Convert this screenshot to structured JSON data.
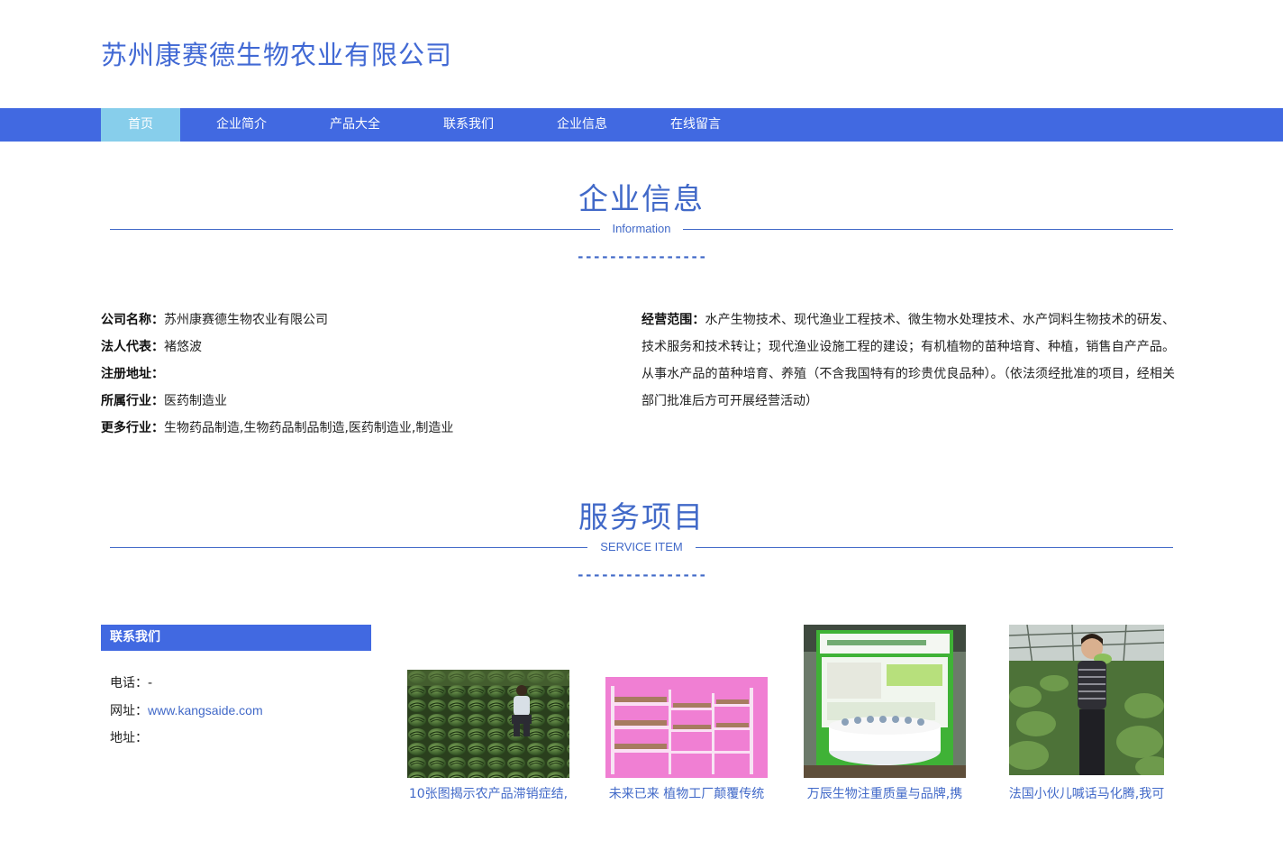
{
  "header": {
    "site_title": "苏州康赛德生物农业有限公司"
  },
  "nav": {
    "items": [
      {
        "label": "首页",
        "active": true
      },
      {
        "label": "企业简介"
      },
      {
        "label": "产品大全"
      },
      {
        "label": "联系我们"
      },
      {
        "label": "企业信息"
      },
      {
        "label": "在线留言"
      }
    ]
  },
  "company_info": {
    "title": "企业信息",
    "subtitle": "Information",
    "dashes": "----------------",
    "name_label": "公司名称：",
    "name_value": "苏州康赛德生物农业有限公司",
    "legal_label": "法人代表：",
    "legal_value": "褚悠波",
    "address_label": "注册地址：",
    "address_value": "",
    "industry_label": "所属行业：",
    "industry_value": "医药制造业",
    "more_label": "更多行业：",
    "more_value": "生物药品制造,生物药品制品制造,医药制造业,制造业",
    "scope_label": "经营范围：",
    "scope_value": "水产生物技术、现代渔业工程技术、微生物水处理技术、水产饲料生物技术的研发、技术服务和技术转让；现代渔业设施工程的建设；有机植物的苗种培育、种植，销售自产产品。从事水产品的苗种培育、养殖（不含我国特有的珍贵优良品种）。（依法须经批准的项目，经相关部门批准后方可开展经营活动）"
  },
  "services": {
    "title": "服务项目",
    "subtitle": "SERVICE ITEM",
    "dashes": "----------------"
  },
  "contact": {
    "heading": "联系我们",
    "phone_label": "电话：",
    "phone_value": "-",
    "web_label": "网址：",
    "web_value": "www.kangsaide.com",
    "addr_label": "地址：",
    "addr_value": ""
  },
  "products": [
    {
      "caption": "10张图揭示农产品滞销症结,",
      "image": "watermelon-field-photo"
    },
    {
      "caption": "未来已来 植物工厂颠覆传统",
      "image": "plant-factory-photo"
    },
    {
      "caption": "万辰生物注重质量与品牌,携",
      "image": "exhibition-booth-photo"
    },
    {
      "caption": "法国小伙儿喊话马化腾,我可",
      "image": "greenhouse-woman-photo"
    }
  ]
}
